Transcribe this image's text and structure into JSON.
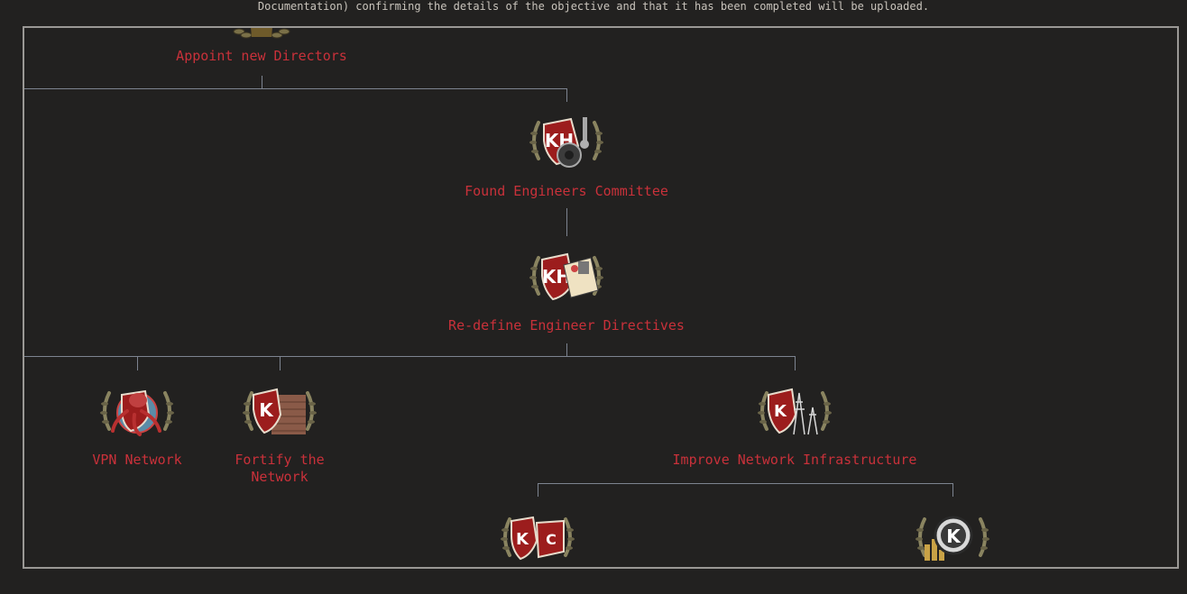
{
  "header": {
    "description_tail": "Documentation) confirming the details of the objective and that it has been completed will be uploaded."
  },
  "focus_tree": {
    "nodes": [
      {
        "id": "appoint",
        "label": "Appoint new Directors",
        "icon": "directors-emblem-icon"
      },
      {
        "id": "found",
        "label": "Found Engineers Committee",
        "icon": "engineers-gear-emblem-icon"
      },
      {
        "id": "redefine",
        "label": "Re-define Engineer Directives",
        "icon": "directives-document-emblem-icon"
      },
      {
        "id": "vpn",
        "label": "VPN Network",
        "icon": "octopus-emblem-icon"
      },
      {
        "id": "fortify",
        "label": "Fortify the Network",
        "icon": "brick-wall-emblem-icon"
      },
      {
        "id": "improve",
        "label": "Improve Network Infrastructure",
        "icon": "power-pylon-emblem-icon"
      },
      {
        "id": "kdc",
        "label": "",
        "icon": "kdc-emblem-icon"
      },
      {
        "id": "kcoin",
        "label": "",
        "icon": "k-coin-emblem-icon"
      }
    ]
  },
  "colors": {
    "background": "#222120",
    "label": "#c9313a",
    "line": "#7d8490",
    "frame": "#9a9895"
  }
}
